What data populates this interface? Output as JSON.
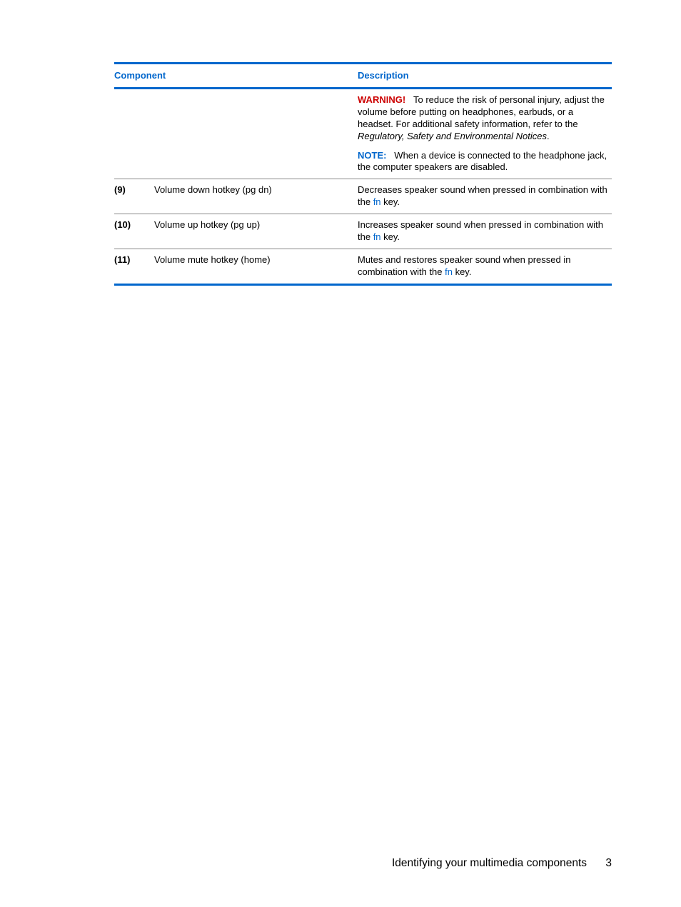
{
  "table": {
    "headers": {
      "component": "Component",
      "description": "Description"
    },
    "warning": {
      "label": "WARNING!",
      "text_before_italic": "To reduce the risk of personal injury, adjust the volume before putting on headphones, earbuds, or a headset. For additional safety information, refer to the ",
      "italic": "Regulatory, Safety and Environmental Notices",
      "text_after_italic": "."
    },
    "note": {
      "label": "NOTE:",
      "text": "When a device is connected to the headphone jack, the computer speakers are disabled."
    },
    "rows": [
      {
        "num": "(9)",
        "component": "Volume down hotkey (pg dn)",
        "desc_before": "Decreases speaker sound when pressed in combination with the ",
        "fn": "fn",
        "desc_after": " key."
      },
      {
        "num": "(10)",
        "component": "Volume up hotkey (pg up)",
        "desc_before": "Increases speaker sound when pressed in combination with the ",
        "fn": "fn",
        "desc_after": " key."
      },
      {
        "num": "(11)",
        "component": "Volume mute hotkey (home)",
        "desc_before": "Mutes and restores speaker sound when pressed in combination with the ",
        "fn": "fn",
        "desc_after": " key."
      }
    ]
  },
  "footer": {
    "text": "Identifying your multimedia components",
    "page": "3"
  }
}
